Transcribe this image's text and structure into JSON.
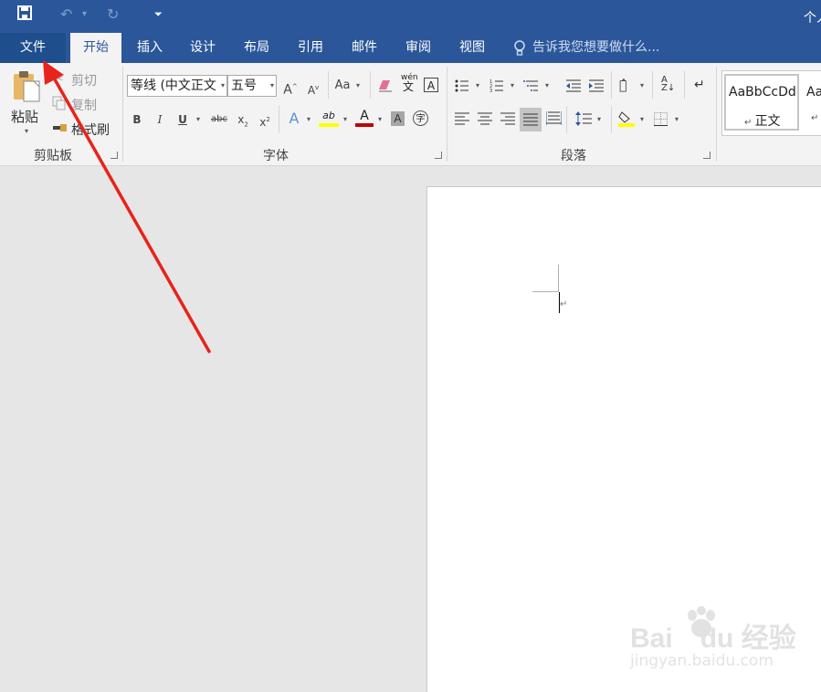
{
  "window": {
    "title_right": "个人"
  },
  "quick_access": {
    "save_icon": "save-icon",
    "undo_icon": "undo-icon",
    "redo_icon": "redo-icon",
    "customize_icon": "customize-icon"
  },
  "tabs": [
    "文件",
    "开始",
    "插入",
    "设计",
    "布局",
    "引用",
    "邮件",
    "审阅",
    "视图"
  ],
  "tell_me": "告诉我您想要做什么...",
  "clipboard": {
    "paste": "粘贴",
    "cut": "剪切",
    "copy": "复制",
    "format_painter": "格式刷",
    "label": "剪贴板"
  },
  "font": {
    "family": "等线 (中文正文",
    "size": "五号",
    "label": "字体",
    "grow": "A",
    "shrink": "A",
    "case": "Aa",
    "pinyin": "wén",
    "bold": "B",
    "italic": "I",
    "underline": "U",
    "strike": "abc",
    "sub": "x",
    "sup": "x",
    "effects": "A",
    "highlight": "ab",
    "color": "A",
    "shade": "A",
    "enclose": "字"
  },
  "paragraph": {
    "label": "段落"
  },
  "styles": {
    "item1_preview": "AaBbCcDd",
    "item1_name": "正文",
    "item2_preview": "Aa"
  },
  "watermark": {
    "brand": "Bai",
    "brand2": "du",
    "brand3": "经验",
    "url": "jingyan.baidu.com"
  },
  "colors": {
    "accent": "#2b579a",
    "annotation": "#e8231b",
    "highlight": "#ffff00",
    "font_color": "#c00000"
  }
}
